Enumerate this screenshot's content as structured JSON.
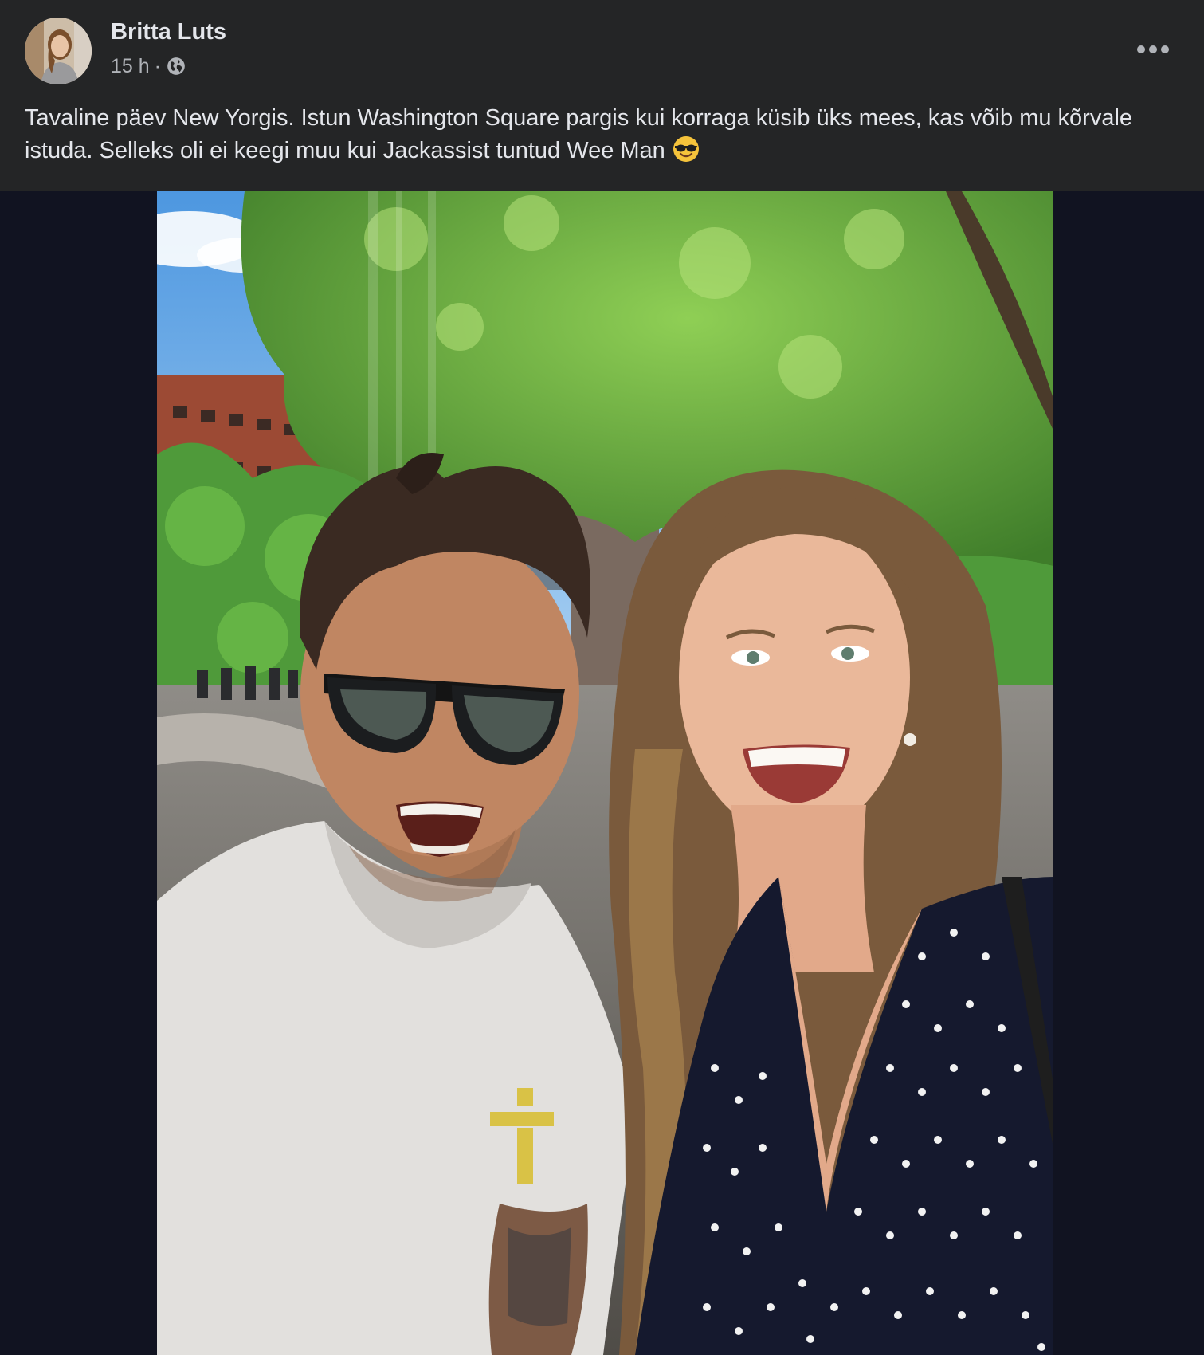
{
  "post": {
    "author_name": "Britta Luts",
    "timestamp": "15 h",
    "separator": "·",
    "audience_icon": "globe-icon",
    "more_icon": "more-options-icon",
    "text": "Tavaline päev New Yorgis. Istun Washington Square pargis kui korraga küsib üks mees, kas võib mu kõrvale istuda. Selleks oli ei keegi muu kui Jackassist tuntud Wee Man",
    "text_emoji": "smiling-face-with-sunglasses-icon"
  },
  "colors": {
    "page_background": "#111321",
    "header_background": "#242526",
    "primary_text": "#e4e6eb",
    "secondary_text": "#b0b3b8"
  }
}
